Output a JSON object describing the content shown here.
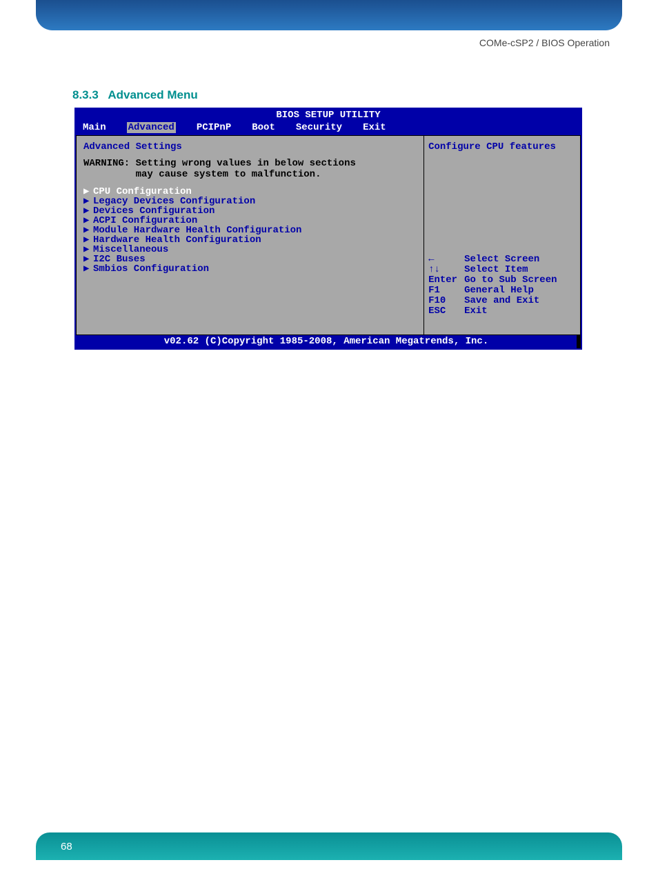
{
  "header": {
    "right": "COMe-cSP2 / BIOS Operation"
  },
  "section": {
    "number": "8.3.3",
    "title": "Advanced Menu"
  },
  "bios": {
    "title": "BIOS SETUP UTILITY",
    "tabs": [
      "Main",
      "Advanced",
      "PCIPnP",
      "Boot",
      "Security",
      "Exit"
    ],
    "active_tab": "Advanced",
    "left_title": "Advanced Settings",
    "warning_label": "WARNING:",
    "warning_l1": "Setting wrong values in below sections",
    "warning_l2": "may cause system to malfunction.",
    "menu": [
      "CPU Configuration",
      "Legacy Devices Configuration",
      "Devices Configuration",
      "ACPI Configuration",
      "Module Hardware Health Configuration",
      "Hardware Health Configuration",
      "Miscellaneous",
      "I2C Buses",
      "Smbios Configuration"
    ],
    "help": "Configure CPU features",
    "keys": [
      {
        "k": "←",
        "d": "Select Screen"
      },
      {
        "k": "↑↓",
        "d": "Select Item"
      },
      {
        "k": "Enter",
        "d": "Go to Sub Screen"
      },
      {
        "k": "F1",
        "d": "General Help"
      },
      {
        "k": "F10",
        "d": "Save and Exit"
      },
      {
        "k": "ESC",
        "d": "Exit"
      }
    ],
    "footer": "v02.62 (C)Copyright 1985-2008, American Megatrends, Inc."
  },
  "page_number": "68"
}
